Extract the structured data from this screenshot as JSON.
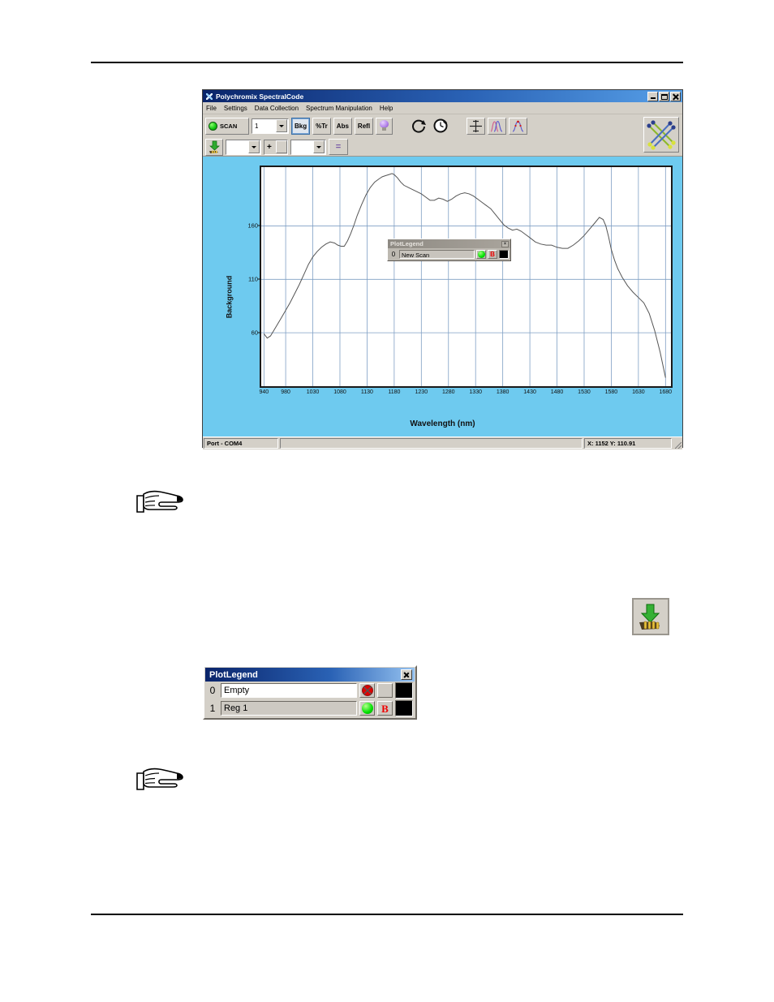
{
  "app": {
    "title": "Polychromix SpectralCode",
    "title_icon": "app-spectral-icon",
    "window_buttons": {
      "minimize": "minimize-button",
      "maximize": "maximize-button",
      "close": "close-button"
    },
    "menu": [
      "File",
      "Settings",
      "Data Collection",
      "Spectrum Manipulation",
      "Help"
    ],
    "toolbar": {
      "scan_label": "SCAN",
      "scan_count_value": "1",
      "mode_buttons": [
        {
          "label": "Bkg",
          "pressed": true
        },
        {
          "label": "%Tr",
          "pressed": false
        },
        {
          "label": "Abs",
          "pressed": false
        },
        {
          "label": "Refl",
          "pressed": false
        }
      ],
      "lamp_icon": "lightbulb-icon",
      "refresh_icon": "circular-arrow-icon",
      "timer_icon": "clock-icon",
      "pan_icon": "crosshair-move-icon",
      "overlay_icon": "overlay-peaks-icon",
      "peakpick_icon": "peak-pick-icon",
      "network_icon": "crossed-lines-icon",
      "download_icon": "download-to-hand-icon",
      "operand_a_value": "",
      "operator_value": "+",
      "operand_b_value": "",
      "equals_label": "="
    },
    "plot": {
      "ylabel": "Background",
      "xlabel": "Wavelength (nm)",
      "legend": {
        "title": "PlotLegend",
        "close_icon": "close-icon",
        "rows": [
          {
            "index": "0",
            "name": "New Scan",
            "marker": "green-dot",
            "flag": "B",
            "color": "#000000"
          }
        ]
      }
    },
    "statusbar": {
      "port": "Port - COM4",
      "message": "",
      "coordinates": "X: 1152 Y: 110.91"
    }
  },
  "figures": {
    "hand_icon_1": "pointing-hand-icon",
    "hand_icon_2": "pointing-hand-icon",
    "download_figure_icon": "download-to-hand-icon"
  },
  "legend_dialog": {
    "title": "PlotLegend",
    "close_icon": "close-icon",
    "rows": [
      {
        "index": "0",
        "name": "Empty",
        "marker": "red-x-dot",
        "flag": "",
        "color": "#000000"
      },
      {
        "index": "1",
        "name": "Reg 1",
        "marker": "green-dot",
        "flag": "B",
        "color": "#000000"
      }
    ]
  },
  "chart_data": {
    "type": "line",
    "title": "",
    "xlabel": "Wavelength (nm)",
    "ylabel": "Background",
    "xlim": [
      935,
      1690
    ],
    "ylim": [
      10,
      215
    ],
    "yticks": [
      60,
      110,
      160
    ],
    "xticks": [
      940,
      980,
      1030,
      1080,
      1130,
      1180,
      1230,
      1280,
      1330,
      1380,
      1430,
      1480,
      1530,
      1580,
      1630,
      1680
    ],
    "grid": true,
    "legend_position": "inside-center",
    "series": [
      {
        "name": "New Scan",
        "color": "#555555",
        "x": [
          940,
          946,
          952,
          958,
          965,
          972,
          980,
          988,
          996,
          1005,
          1014,
          1022,
          1030,
          1038,
          1046,
          1054,
          1062,
          1070,
          1076,
          1082,
          1088,
          1094,
          1100,
          1106,
          1112,
          1120,
          1128,
          1136,
          1144,
          1152,
          1158,
          1164,
          1170,
          1176,
          1180,
          1186,
          1192,
          1198,
          1206,
          1214,
          1222,
          1230,
          1238,
          1246,
          1254,
          1262,
          1270,
          1278,
          1286,
          1294,
          1302,
          1310,
          1318,
          1326,
          1334,
          1342,
          1350,
          1358,
          1366,
          1374,
          1382,
          1390,
          1398,
          1406,
          1414,
          1422,
          1430,
          1440,
          1450,
          1460,
          1470,
          1480,
          1490,
          1500,
          1510,
          1520,
          1530,
          1540,
          1550,
          1558,
          1565,
          1570,
          1575,
          1580,
          1586,
          1592,
          1600,
          1610,
          1620,
          1630,
          1640,
          1650,
          1660,
          1670,
          1680
        ],
        "y": [
          59,
          55,
          57,
          62,
          68,
          74,
          81,
          88,
          96,
          105,
          115,
          124,
          131,
          136,
          140,
          143,
          145,
          144,
          142,
          141,
          141,
          146,
          153,
          161,
          170,
          180,
          189,
          196,
          201,
          204,
          206,
          207,
          208,
          209,
          208,
          205,
          201,
          198,
          196,
          194,
          192,
          190,
          187,
          184,
          184,
          186,
          185,
          183,
          185,
          188,
          190,
          191,
          190,
          188,
          185,
          182,
          179,
          176,
          171,
          166,
          161,
          158,
          156,
          157,
          155,
          152,
          149,
          145,
          143,
          142,
          142,
          140,
          139,
          139,
          142,
          146,
          151,
          157,
          163,
          168,
          166,
          160,
          150,
          138,
          128,
          120,
          112,
          104,
          98,
          93,
          88,
          78,
          62,
          42,
          18
        ]
      }
    ]
  }
}
